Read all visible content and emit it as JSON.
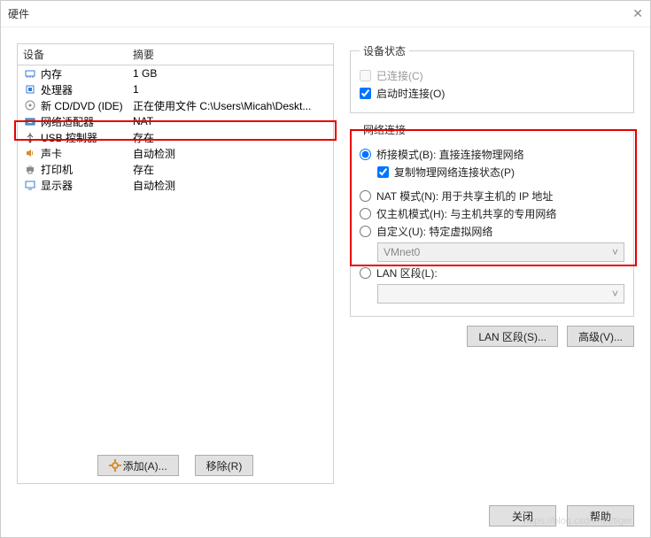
{
  "window": {
    "title": "硬件"
  },
  "deviceTable": {
    "header": {
      "device": "设备",
      "summary": "摘要"
    },
    "rows": [
      {
        "name": "内存",
        "summary": "1 GB",
        "icon": "memory"
      },
      {
        "name": "处理器",
        "summary": "1",
        "icon": "cpu"
      },
      {
        "name": "新 CD/DVD (IDE)",
        "summary": "正在使用文件 C:\\Users\\Micah\\Deskt...",
        "icon": "disc"
      },
      {
        "name": "网络适配器",
        "summary": "NAT",
        "icon": "nic"
      },
      {
        "name": "USB 控制器",
        "summary": "存在",
        "icon": "usb"
      },
      {
        "name": "声卡",
        "summary": "自动检测",
        "icon": "sound"
      },
      {
        "name": "打印机",
        "summary": "存在",
        "icon": "printer"
      },
      {
        "name": "显示器",
        "summary": "自动检测",
        "icon": "display"
      }
    ]
  },
  "leftButtons": {
    "add": "添加(A)...",
    "remove": "移除(R)"
  },
  "deviceStatus": {
    "legend": "设备状态",
    "connected": {
      "label": "已连接(C)",
      "checked": false,
      "disabled": true
    },
    "connectAtPowerOn": {
      "label": "启动时连接(O)",
      "checked": true
    }
  },
  "networkConnection": {
    "legend": "网络连接",
    "bridged": {
      "label": "桥接模式(B): 直接连接物理网络",
      "selected": true
    },
    "replicate": {
      "label": "复制物理网络连接状态(P)",
      "checked": true
    },
    "nat": {
      "label": "NAT 模式(N): 用于共享主机的 IP 地址",
      "selected": false
    },
    "hostOnly": {
      "label": "仅主机模式(H): 与主机共享的专用网络",
      "selected": false
    },
    "custom": {
      "label": "自定义(U): 特定虚拟网络",
      "selected": false
    },
    "customCombo": "VMnet0",
    "lanSegment": {
      "label": "LAN 区段(L):",
      "selected": false
    }
  },
  "rightButtons": {
    "lanSegments": "LAN 区段(S)...",
    "advanced": "高级(V)..."
  },
  "footer": {
    "close": "关闭",
    "help": "帮助"
  },
  "watermark": "https://blog.csdn.net/tiger"
}
